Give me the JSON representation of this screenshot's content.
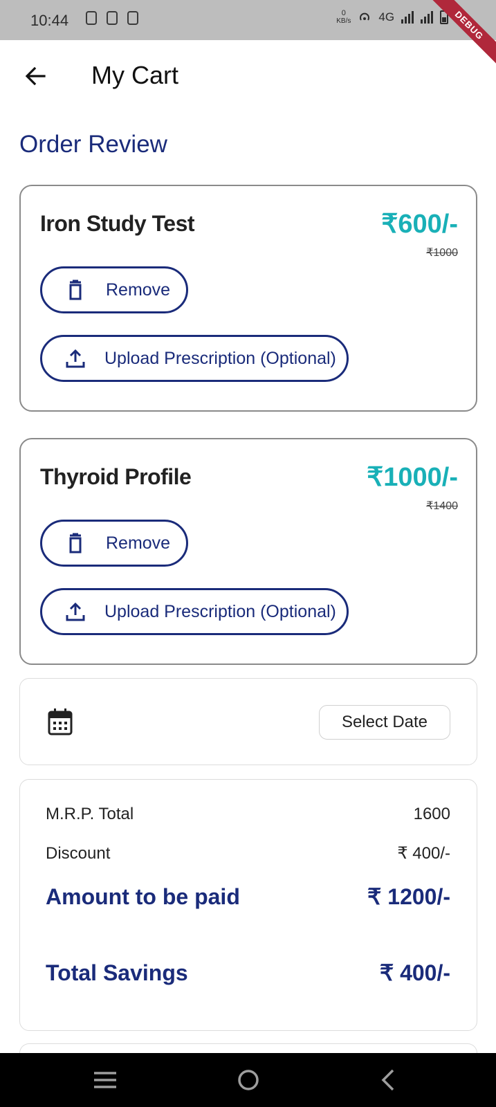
{
  "status_bar": {
    "time": "10:44",
    "data_rate_value": "0",
    "data_rate_unit": "KB/s",
    "network": "4G",
    "battery": "53",
    "debug_banner": "DEBUG"
  },
  "app_bar": {
    "title": "My Cart",
    "back_icon": "arrow-left-icon"
  },
  "section_heading": "Order Review",
  "cart_items": [
    {
      "name": "Iron Study Test",
      "price": "₹600/-",
      "mrp": "₹1000",
      "remove_label": "Remove",
      "upload_label": "Upload Prescription (Optional)"
    },
    {
      "name": "Thyroid Profile",
      "price": "₹1000/-",
      "mrp": "₹1400",
      "remove_label": "Remove",
      "upload_label": "Upload Prescription (Optional)"
    }
  ],
  "date_picker": {
    "icon": "calendar-icon",
    "button_label": "Select Date"
  },
  "summary": {
    "mrp_total_label": "M.R.P. Total",
    "mrp_total_value": "1600",
    "discount_label": "Discount",
    "discount_value": "₹ 400/-",
    "amount_label": "Amount to be paid",
    "amount_value": "₹ 1200/-",
    "savings_label": "Total Savings",
    "savings_value": "₹ 400/-"
  },
  "colors": {
    "primary": "#1a2b7a",
    "price_accent": "#19b0b7",
    "status_bar": "#bdbdbd",
    "debug_ribbon": "#b0283b"
  },
  "nav_bar": {
    "icons": [
      "menu-icon",
      "home-icon",
      "back-icon"
    ]
  }
}
